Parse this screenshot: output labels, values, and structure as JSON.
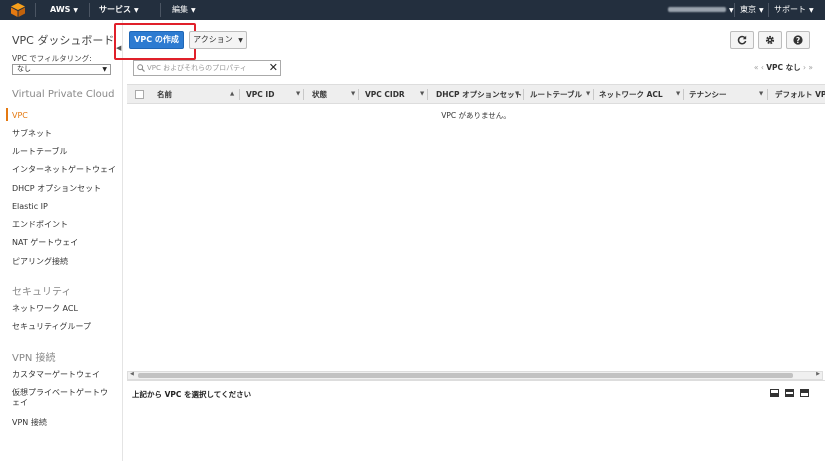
{
  "topbar": {
    "brand": "AWS",
    "services_menu": "サービス",
    "edit_menu": "編集",
    "region": "東京",
    "support": "サポート"
  },
  "sidebar": {
    "dashboard_title": "VPC ダッシュボード",
    "filter_label": "VPC でフィルタリング:",
    "filter_value": "なし",
    "sections": [
      {
        "heading": "Virtual Private Cloud",
        "items": [
          "VPC",
          "サブネット",
          "ルートテーブル",
          "インターネットゲートウェイ",
          "DHCP オプションセット",
          "Elastic IP",
          "エンドポイント",
          "NAT ゲートウェイ",
          "ピアリング接続"
        ]
      },
      {
        "heading": "セキュリティ",
        "items": [
          "ネットワーク ACL",
          "セキュリティグループ"
        ]
      },
      {
        "heading": "VPN 接続",
        "items": [
          "カスタマーゲートウェイ",
          "仮想プライベートゲートウェイ",
          "VPN 接続"
        ]
      }
    ],
    "active_item": "VPC"
  },
  "toolbar": {
    "create_vpc": "VPC の作成",
    "actions": "アクション",
    "refresh_icon": "refresh-icon",
    "settings_icon": "gear-icon",
    "help_icon": "help-icon"
  },
  "search": {
    "placeholder": "VPC およびそれらのプロパティ",
    "value": ""
  },
  "pager": {
    "first": "«",
    "prev": "‹",
    "label": "VPC なし",
    "next": "›",
    "last": "»"
  },
  "table": {
    "columns": [
      "名前",
      "VPC ID",
      "状態",
      "VPC CIDR",
      "DHCP オプションセット",
      "ルートテーブル",
      "ネットワーク ACL",
      "テナンシー",
      "デフォルト VPC"
    ],
    "empty_message": "VPC がありません。"
  },
  "detail": {
    "message": "上記から VPC を選択してください"
  },
  "colors": {
    "topbar": "#232f3e",
    "primary_button": "#2d7bd1",
    "active_nav": "#e47911",
    "highlight": "#e0202a"
  }
}
